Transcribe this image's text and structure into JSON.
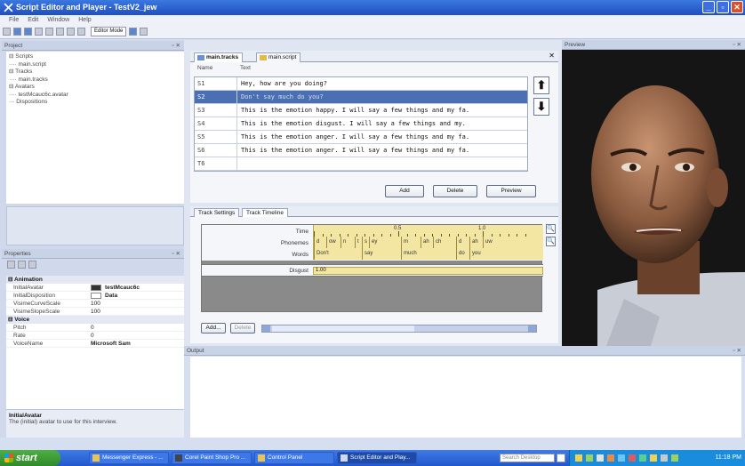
{
  "window": {
    "title": "Script Editor and Player - TestV2_jew",
    "minimize": "_",
    "maximize": "▫",
    "close": "✕"
  },
  "menu": [
    "File",
    "Edit",
    "Window",
    "Help"
  ],
  "toolbar": {
    "mode": "Editor Mode"
  },
  "project": {
    "header": "Project",
    "pin": "▫ ✕",
    "tree": [
      "⊟ Scripts",
      "···· main.script",
      "⊟ Tracks",
      "···· main.tracks",
      "⊟ Avatars",
      "···· testMcauc6c.avatar",
      "··· Dispositions"
    ]
  },
  "properties": {
    "header": "Properties",
    "pin": "▫ ✕",
    "categories": [
      {
        "name": "Animation",
        "rows": [
          {
            "key": "InitialAvatar",
            "value": "testMcauc6c",
            "swatch": "#333333"
          },
          {
            "key": "InitialDisposition",
            "value": "Data",
            "swatch": "#ffffff"
          },
          {
            "key": "VisimeCurveScale",
            "value": "100"
          },
          {
            "key": "VisimeSlopeScale",
            "value": "100"
          }
        ]
      },
      {
        "name": "Voice",
        "rows": [
          {
            "key": "Pitch",
            "value": "0"
          },
          {
            "key": "Rate",
            "value": "0"
          },
          {
            "key": "VoiceName",
            "value": "Microsoft Sam"
          }
        ]
      }
    ],
    "desc_title": "InitialAvatar",
    "desc_text": "The (initial) avatar to use for this interview."
  },
  "editor": {
    "tabs": [
      "main.tracks",
      "main.script"
    ],
    "close": "✕",
    "col_name": "Name",
    "col_text": "Text",
    "rows": [
      {
        "name": "S1",
        "text": "Hey, how are you doing?"
      },
      {
        "name": "S2",
        "text": "Don't say much do you?"
      },
      {
        "name": "S3",
        "text": "This is the emotion happy.  I will say a few things and my fa."
      },
      {
        "name": "S4",
        "text": "This is the emotion disgust.  I will say a few things and my."
      },
      {
        "name": "S5",
        "text": "This is the emotion anger.  I will say a few things and my fa."
      },
      {
        "name": "S6",
        "text": "This is the emotion anger.  I will say a few things and my fa."
      },
      {
        "name": "T6",
        "text": ""
      }
    ],
    "selected_index": 1,
    "up": "⬆",
    "down": "⬇",
    "add": "Add",
    "delete": "Delete",
    "preview": "Preview"
  },
  "timeline": {
    "tabs": [
      "Track Settings",
      "Track Timeline"
    ],
    "label_time": "Time",
    "label_phonemes": "Phonemes",
    "label_words": "Words",
    "label_disgust": "Disgust",
    "time_marks": [
      "0.5",
      "1.0"
    ],
    "phonemes": [
      "d",
      "ow",
      "n",
      "t",
      "s",
      "ey",
      "m",
      "ah",
      "ch",
      "d",
      "ah",
      "uw"
    ],
    "words": [
      "Don't",
      "say",
      "much",
      "do",
      "you"
    ],
    "disgust_value": "1.00",
    "zoom_in": "🔍",
    "add": "Add...",
    "delete": "Delete"
  },
  "preview": {
    "header": "Preview",
    "pin": "▫ ✕"
  },
  "output": {
    "header": "Output",
    "pin": "▫ ✕"
  },
  "taskbar": {
    "start": "start",
    "tasks": [
      "Messenger Express - ...",
      "Corel Paint Shop Pro ...",
      "Control Panel",
      "Script Editor and Play..."
    ],
    "search": "Search Desktop",
    "clock": "11:18 PM"
  }
}
